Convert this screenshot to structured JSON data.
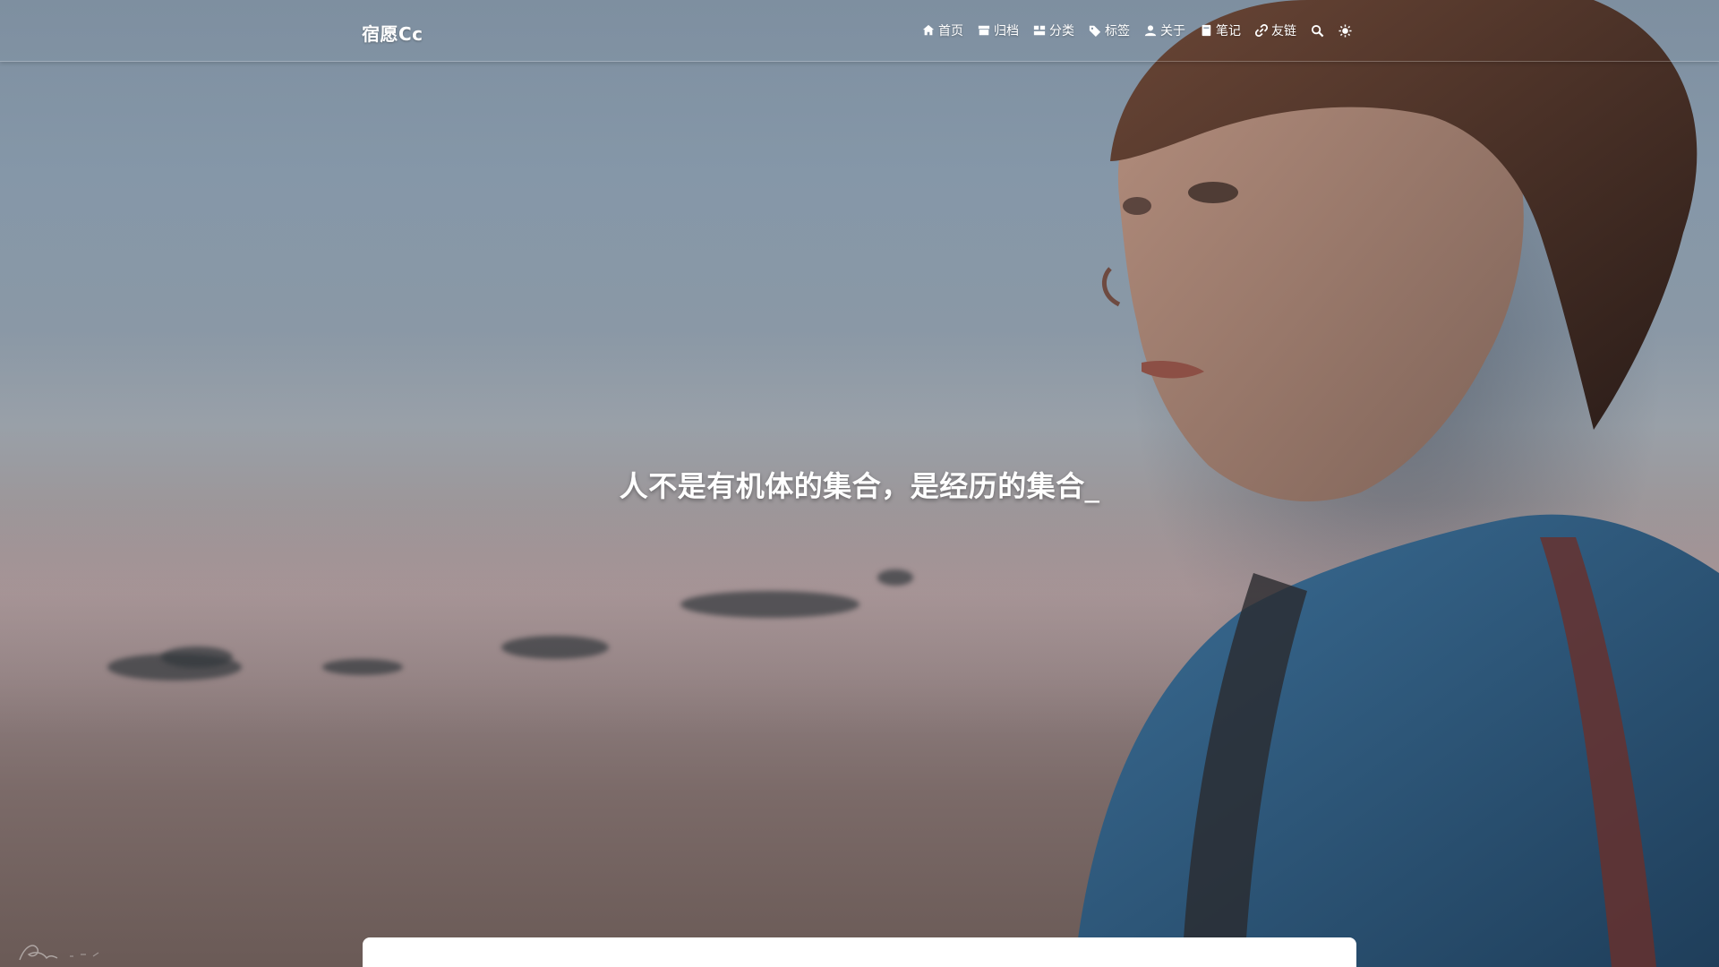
{
  "brand": {
    "title": "宿愿Cc"
  },
  "nav": {
    "items": [
      {
        "label": "首页",
        "icon": "home-icon"
      },
      {
        "label": "归档",
        "icon": "archive-icon"
      },
      {
        "label": "分类",
        "icon": "category-icon"
      },
      {
        "label": "标签",
        "icon": "tag-icon"
      },
      {
        "label": "关于",
        "icon": "user-icon"
      },
      {
        "label": "笔记",
        "icon": "book-icon"
      },
      {
        "label": "友链",
        "icon": "link-icon"
      }
    ],
    "search_icon": "search-icon",
    "theme_icon": "sun-icon"
  },
  "hero": {
    "subtitle": "人不是有机体的集合，是经历的集合",
    "cursor": "_"
  },
  "colors": {
    "text": "#ffffff",
    "card": "#ffffff"
  }
}
